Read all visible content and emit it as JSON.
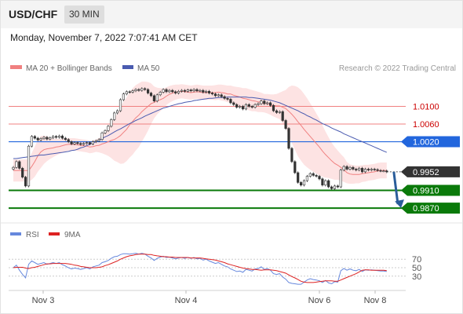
{
  "header": {
    "symbol": "USD/CHF",
    "timeframe": "30 MIN"
  },
  "datetime": "Monday, November 7, 2022 7:07:41 AM CET",
  "legend": {
    "ma20": "MA 20 + Bollinger Bands",
    "ma50": "MA 50",
    "credit": "Research © 2022 Trading Central",
    "rsi": "RSI",
    "ma9": "9MA"
  },
  "colors": {
    "ma20": "#f08080",
    "bands": "#fde3e3",
    "ma50": "#4a5bb0",
    "resistance": "#f08080",
    "pivot": "#2266dd",
    "support": "#0a7a0a",
    "current": "#333333",
    "arrow": "#2a5d9a",
    "rsi": "#6688dd",
    "rsi_ma": "#dd2222"
  },
  "icons": {
    "scenario-arrow": "arrow-down-right-icon"
  },
  "chart_data": {
    "type": "candlestick",
    "x_labels": [
      "Nov 3",
      "Nov 4",
      "Nov 6",
      "Nov 8"
    ],
    "ylim": [
      0.984,
      1.017
    ],
    "levels": [
      {
        "value": 1.01,
        "label": "1.0100",
        "kind": "resistance"
      },
      {
        "value": 1.006,
        "label": "1.0060",
        "kind": "resistance"
      },
      {
        "value": 1.002,
        "label": "1.0020",
        "kind": "pivot"
      },
      {
        "value": 0.9952,
        "label": "0.9952",
        "kind": "current"
      },
      {
        "value": 0.991,
        "label": "0.9910",
        "kind": "support"
      },
      {
        "value": 0.987,
        "label": "0.9870",
        "kind": "support"
      }
    ],
    "closes": [
      0.9962,
      0.9975,
      0.996,
      0.994,
      0.992,
      1.001,
      1.0032,
      1.0028,
      1.0024,
      1.0027,
      1.003,
      1.0026,
      1.0029,
      1.0032,
      1.003,
      1.0033,
      1.0028,
      1.0025,
      1.002,
      1.0015,
      1.0018,
      1.0016,
      1.0014,
      1.0016,
      1.0018,
      1.0015,
      1.002,
      1.0022,
      1.0025,
      1.004,
      1.0045,
      1.0055,
      1.007,
      1.0085,
      1.009,
      1.0115,
      1.0128,
      1.0133,
      1.0132,
      1.0135,
      1.0138,
      1.0136,
      1.014,
      1.0138,
      1.013,
      1.0124,
      1.0112,
      1.0126,
      1.0132,
      1.0138,
      1.0133,
      1.0136,
      1.0133,
      1.013,
      1.0134,
      1.0136,
      1.0134,
      1.0137,
      1.0135,
      1.0138,
      1.0135,
      1.0136,
      1.0132,
      1.0134,
      1.013,
      1.0128,
      1.0124,
      1.0126,
      1.0122,
      1.0118,
      1.0116,
      1.0108,
      1.0104,
      1.0098,
      1.01,
      1.0094,
      1.0104,
      1.01,
      1.0098,
      1.0104,
      1.0106,
      1.0112,
      1.0106,
      1.0108,
      1.0102,
      1.009,
      1.0086,
      1.0088,
      1.0068,
      1.005,
      1.0005,
      0.9975,
      0.995,
      0.9928,
      0.9922,
      0.9932,
      0.9942,
      0.9948,
      0.9944,
      0.9942,
      0.9936,
      0.9922,
      0.9932,
      0.9918,
      0.9914,
      0.992,
      0.9918,
      0.9956,
      0.9964,
      0.9958,
      0.9962,
      0.9958,
      0.9956,
      0.996,
      0.9952,
      0.9958,
      0.9956,
      0.9958,
      0.9957,
      0.9955,
      0.9954,
      0.9954,
      0.9952
    ],
    "ma20": [
      0.9955,
      0.9955,
      0.9955,
      0.9955,
      0.9955,
      0.9955,
      0.9964,
      0.9975,
      0.9988,
      0.9997,
      1.0002,
      1.0004,
      1.0005,
      1.0006,
      1.0008,
      1.0009,
      1.0011,
      1.0013,
      1.0014,
      1.0014,
      1.0014,
      1.0013,
      1.0012,
      1.0011,
      1.001,
      1.0008,
      1.0009,
      1.0011,
      1.0012,
      1.0015,
      1.0017,
      1.002,
      1.0023,
      1.0025,
      1.0029,
      1.0034,
      1.0041,
      1.0048,
      1.0058,
      1.0066,
      1.0074,
      1.008,
      1.0088,
      1.0094,
      1.01,
      1.0106,
      1.0109,
      1.0112,
      1.0115,
      1.0118,
      1.0123,
      1.0127,
      1.013,
      1.0132,
      1.0133,
      1.0134,
      1.0133,
      1.0132,
      1.0131,
      1.0132,
      1.0133,
      1.0132,
      1.0131,
      1.0131,
      1.0131,
      1.0131,
      1.0131,
      1.0132,
      1.0131,
      1.013,
      1.0128,
      1.0128,
      1.0125,
      1.0123,
      1.0121,
      1.0118,
      1.0117,
      1.0115,
      1.0113,
      1.0112,
      1.011,
      1.0109,
      1.0107,
      1.0106,
      1.0104,
      1.0102,
      1.0101,
      1.0101,
      1.0098,
      1.0095,
      1.0089,
      1.0082,
      1.0074,
      1.0065,
      1.0057,
      1.0048,
      1.004,
      1.0032,
      1.0024,
      1.0016,
      1.0008,
      0.9999,
      0.9991,
      0.9984,
      0.9977,
      0.9971,
      0.9967,
      0.9962,
      0.9957,
      0.995,
      0.9947,
      0.9946,
      0.9946,
      0.9946,
      0.9948,
      0.9949,
      0.995,
      0.9951,
      0.9952,
      0.9954,
      0.9955,
      0.9955,
      0.9955
    ],
    "ma50": [
      0.9982,
      0.9982,
      0.9983,
      0.9984,
      0.9985,
      0.9986,
      0.9987,
      0.9988,
      0.9989,
      0.999,
      0.999,
      0.9991,
      0.9992,
      0.9993,
      0.9994,
      0.9995,
      0.9996,
      0.9997,
      0.9998,
      1.0,
      1.0001,
      1.0003,
      1.0006,
      1.0008,
      1.0011,
      1.0014,
      1.0017,
      1.002,
      1.0024,
      1.0027,
      1.0031,
      1.0034,
      1.0038,
      1.0042,
      1.0046,
      1.0049,
      1.0053,
      1.0057,
      1.0061,
      1.0064,
      1.0068,
      1.0071,
      1.0074,
      1.0078,
      1.0081,
      1.0084,
      1.0087,
      1.009,
      1.0093,
      1.0096,
      1.0098,
      1.01,
      1.0102,
      1.0104,
      1.0106,
      1.0107,
      1.0109,
      1.011,
      1.0111,
      1.0113,
      1.0114,
      1.0115,
      1.0116,
      1.0117,
      1.0118,
      1.0118,
      1.0119,
      1.012,
      1.012,
      1.012,
      1.0121,
      1.0121,
      1.0121,
      1.0121,
      1.0121,
      1.0121,
      1.0121,
      1.012,
      1.012,
      1.0119,
      1.0118,
      1.0117,
      1.0116,
      1.0115,
      1.0114,
      1.0112,
      1.011,
      1.0108,
      1.0105,
      1.0102,
      1.0099,
      1.0096,
      1.0093,
      1.009,
      1.0086,
      1.0083,
      1.0079,
      1.0076,
      1.0072,
      1.0069,
      1.0065,
      1.0061,
      1.0058,
      1.0055,
      1.0051,
      1.0048,
      1.0045,
      1.0042,
      1.0038,
      1.0035,
      1.0032,
      1.0029,
      1.0026,
      1.0023,
      1.002,
      1.0017,
      1.0014,
      1.0011,
      1.0008,
      1.0005,
      1.0002,
      0.9999,
      0.9996
    ],
    "bollinger_width": [
      0.0025,
      0.0025,
      0.0025,
      0.0025,
      0.0025,
      0.0025,
      0.003,
      0.0034,
      0.0036,
      0.0036,
      0.0032,
      0.0028,
      0.0024,
      0.0021,
      0.0019,
      0.0017,
      0.0016,
      0.0015,
      0.0014,
      0.0014,
      0.0014,
      0.0014,
      0.0014,
      0.0014,
      0.0014,
      0.0014,
      0.0014,
      0.0014,
      0.0016,
      0.0021,
      0.0026,
      0.0032,
      0.004,
      0.0048,
      0.0055,
      0.0064,
      0.007,
      0.0072,
      0.0074,
      0.0075,
      0.0074,
      0.0072,
      0.0068,
      0.0062,
      0.0055,
      0.0046,
      0.0036,
      0.003,
      0.0026,
      0.0022,
      0.002,
      0.0019,
      0.0018,
      0.0017,
      0.0016,
      0.0016,
      0.0016,
      0.0016,
      0.0016,
      0.0016,
      0.0016,
      0.0016,
      0.0016,
      0.0016,
      0.0016,
      0.0016,
      0.0017,
      0.0017,
      0.0018,
      0.0018,
      0.0019,
      0.0019,
      0.002,
      0.0021,
      0.0022,
      0.0023,
      0.0024,
      0.0024,
      0.0024,
      0.0023,
      0.0023,
      0.0022,
      0.0021,
      0.0022,
      0.0023,
      0.0025,
      0.0027,
      0.003,
      0.0036,
      0.0042,
      0.0055,
      0.0065,
      0.0072,
      0.0078,
      0.008,
      0.008,
      0.0078,
      0.0075,
      0.0072,
      0.0068,
      0.0064,
      0.0058,
      0.0052,
      0.0046,
      0.0041,
      0.0037,
      0.0033,
      0.003,
      0.0028,
      0.0024,
      0.0022,
      0.0021,
      0.002,
      0.002,
      0.0019,
      0.0019,
      0.0018,
      0.0018,
      0.0018,
      0.0018,
      0.0018,
      0.0018,
      0.0018
    ],
    "projection": {
      "from": 0.9952,
      "to": 0.987
    },
    "rsi": {
      "ylim": [
        0,
        100
      ],
      "levels": [
        70,
        50,
        30
      ],
      "level_labels": [
        "70",
        "50",
        "30"
      ],
      "values": [
        50,
        56,
        44,
        34,
        26,
        58,
        66,
        62,
        58,
        60,
        62,
        58,
        60,
        62,
        60,
        62,
        57,
        54,
        50,
        47,
        49,
        48,
        46,
        48,
        50,
        47,
        52,
        54,
        56,
        62,
        64,
        67,
        72,
        76,
        77,
        81,
        83,
        83,
        82,
        83,
        84,
        82,
        84,
        82,
        77,
        73,
        67,
        72,
        75,
        77,
        74,
        75,
        73,
        71,
        73,
        74,
        72,
        74,
        72,
        74,
        71,
        72,
        68,
        70,
        66,
        63,
        60,
        62,
        58,
        54,
        52,
        47,
        44,
        41,
        42,
        39,
        46,
        44,
        42,
        47,
        48,
        52,
        46,
        48,
        44,
        36,
        34,
        36,
        28,
        23,
        15,
        13,
        12,
        11,
        11,
        16,
        21,
        24,
        22,
        21,
        19,
        15,
        20,
        14,
        12,
        17,
        16,
        43,
        48,
        44,
        47,
        44,
        43,
        46,
        41,
        45,
        44,
        45,
        44,
        43,
        42,
        42,
        41
      ],
      "ma9": [
        50,
        51,
        51,
        51,
        49,
        48,
        50,
        51,
        53,
        55,
        57,
        59,
        59,
        60,
        60,
        60,
        60,
        60,
        59,
        58,
        56,
        55,
        53,
        52,
        51,
        50,
        50,
        50,
        51,
        52,
        55,
        57,
        60,
        63,
        66,
        70,
        73,
        76,
        78,
        79,
        81,
        82,
        82,
        82,
        81,
        81,
        79,
        78,
        77,
        76,
        76,
        75,
        75,
        74,
        74,
        74,
        74,
        74,
        73,
        73,
        73,
        73,
        72,
        71,
        70,
        69,
        68,
        66,
        64,
        62,
        59,
        57,
        55,
        53,
        51,
        49,
        48,
        47,
        46,
        46,
        45,
        44,
        45,
        45,
        45,
        44,
        43,
        41,
        39,
        37,
        33,
        29,
        26,
        22,
        18,
        16,
        15,
        15,
        15,
        16,
        17,
        18,
        19,
        19,
        19,
        18,
        18,
        21,
        24,
        27,
        30,
        33,
        36,
        40,
        44,
        45,
        45,
        44,
        44,
        44,
        44,
        44,
        43
      ]
    }
  }
}
